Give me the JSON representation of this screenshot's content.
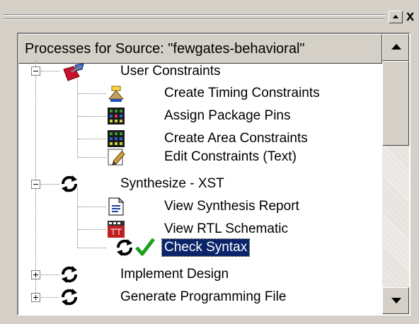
{
  "window": {
    "float_button_icon": "scroll-up-arrow-icon",
    "close_label": "x"
  },
  "panel": {
    "header": "Processes for Source:  \"fewgates-behavioral\""
  },
  "tree": {
    "user_constraints": {
      "label": "User Constraints",
      "icon": "wrench-tools-icon",
      "children": [
        {
          "label": "Create Timing Constraints",
          "icon": "timing-constraints-icon"
        },
        {
          "label": "Assign Package Pins",
          "icon": "package-pins-icon"
        },
        {
          "label": "Create Area Constraints",
          "icon": "area-constraints-icon"
        },
        {
          "label": "Edit Constraints (Text)",
          "icon": "edit-text-icon"
        }
      ]
    },
    "synthesize": {
      "label": "Synthesize - XST",
      "icon": "run-process-icon",
      "children": [
        {
          "label": "View Synthesis Report",
          "icon": "report-document-icon"
        },
        {
          "label": "View RTL Schematic",
          "icon": "schematic-icon"
        },
        {
          "label": "Check Syntax",
          "icon": "check-syntax-icon",
          "selected": true
        }
      ]
    },
    "implement": {
      "label": "Implement Design",
      "icon": "run-process-icon"
    },
    "generate": {
      "label": "Generate Programming File",
      "icon": "run-process-icon"
    }
  },
  "colors": {
    "selection_bg": "#0a246a",
    "selection_fg": "#ffffff",
    "check_green": "#1aa01a",
    "panel_gray": "#d4d0c8"
  }
}
